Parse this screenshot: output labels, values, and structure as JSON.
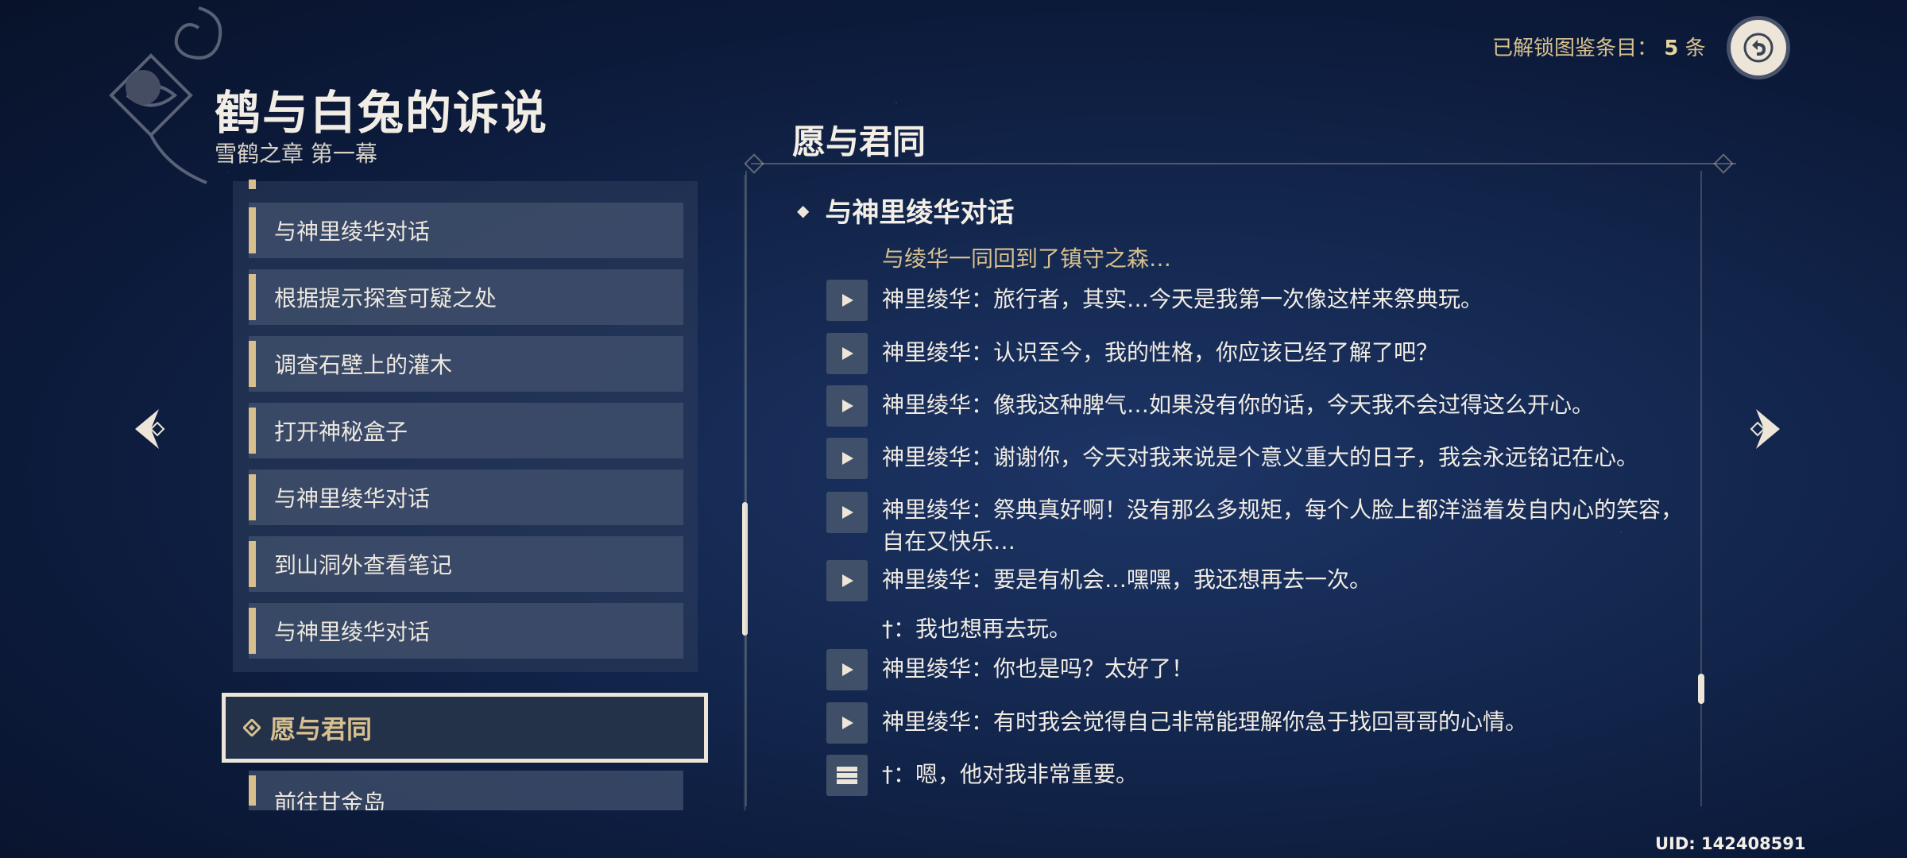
{
  "header": {
    "title": "鹤与白兔的诉说",
    "subtitle": "雪鹤之章 第一幕",
    "unlock_label": "已解锁图鉴条目：",
    "unlock_count": "5",
    "unlock_unit": "条"
  },
  "quest_list": {
    "items": [
      {
        "label": "与神里绫华对话"
      },
      {
        "label": "根据提示探查可疑之处"
      },
      {
        "label": "调查石壁上的灌木"
      },
      {
        "label": "打开神秘盒子"
      },
      {
        "label": "与神里绫华对话"
      },
      {
        "label": "到山洞外查看笔记"
      },
      {
        "label": "与神里绫华对话"
      }
    ],
    "selected": {
      "label": "愿与君同"
    },
    "after_selected": {
      "label": "前往甘金岛"
    }
  },
  "detail": {
    "section_title": "愿与君同",
    "quest_heading": "与神里绫华对话",
    "narration": "与绫华一同回到了镇守之森…",
    "lines": [
      {
        "text": "神里绫华：旅行者，其实…今天是我第一次像这样来祭典玩。"
      },
      {
        "text": "神里绫华：认识至今，我的性格，你应该已经了解了吧？"
      },
      {
        "text": "神里绫华：像我这种脾气…如果没有你的话，今天我不会过得这么开心。"
      },
      {
        "text": "神里绫华：谢谢你，今天对我来说是个意义重大的日子，我会永远铭记在心。"
      },
      {
        "text": "神里绫华：祭典真好啊！没有那么多规矩，每个人脸上都洋溢着发自内心的笑容，自在又快乐…"
      },
      {
        "text": "神里绫华：要是有机会…嘿嘿，我还想再去一次。"
      },
      {
        "text": "神里绫华：你也是吗？太好了！"
      },
      {
        "text": "神里绫华：有时我会觉得自己非常能理解你急于找回哥哥的心情。"
      }
    ],
    "option_1": "†：我也想再去玩。",
    "option_2": "†：嗯，他对我非常重要。"
  },
  "footer": {
    "uid": "UID: 142408591"
  },
  "icons": {
    "back": "back-arrow-icon",
    "prev": "chevron-left-icon",
    "next": "chevron-right-icon",
    "play": "play-icon",
    "book": "book-icon"
  },
  "colors": {
    "gold": "#d7c08e",
    "text": "#ece5d8",
    "background": "#142850"
  }
}
